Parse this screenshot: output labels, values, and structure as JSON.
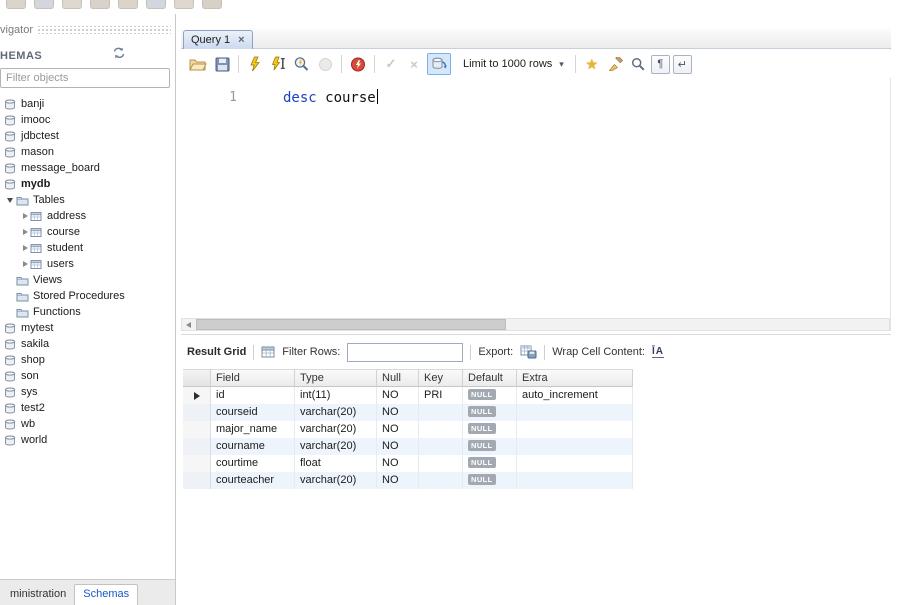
{
  "sidebar": {
    "navigator_title": "vigator",
    "schemas_title": "HEMAS",
    "filter_placeholder": "Filter objects",
    "bottom_tabs": [
      {
        "label": "ministration",
        "active": false
      },
      {
        "label": "Schemas",
        "active": true
      }
    ],
    "tree": [
      {
        "label": "banji",
        "type": "schema",
        "indent": 0
      },
      {
        "label": "imooc",
        "type": "schema",
        "indent": 0
      },
      {
        "label": "jdbctest",
        "type": "schema",
        "indent": 0
      },
      {
        "label": "mason",
        "type": "schema",
        "indent": 0
      },
      {
        "label": "message_board",
        "type": "schema",
        "indent": 0
      },
      {
        "label": "mydb",
        "type": "schema",
        "indent": 0,
        "bold": true
      },
      {
        "label": "Tables",
        "type": "folder",
        "indent": 1,
        "arrow": "down"
      },
      {
        "label": "address",
        "type": "table",
        "indent": 2,
        "arrow": "right"
      },
      {
        "label": "course",
        "type": "table",
        "indent": 2,
        "arrow": "right"
      },
      {
        "label": "student",
        "type": "table",
        "indent": 2,
        "arrow": "right"
      },
      {
        "label": "users",
        "type": "table",
        "indent": 2,
        "arrow": "right"
      },
      {
        "label": "Views",
        "type": "folder",
        "indent": 1
      },
      {
        "label": "Stored Procedures",
        "type": "folder",
        "indent": 1
      },
      {
        "label": "Functions",
        "type": "folder",
        "indent": 1
      },
      {
        "label": "mytest",
        "type": "schema",
        "indent": 0
      },
      {
        "label": "sakila",
        "type": "schema",
        "indent": 0
      },
      {
        "label": "shop",
        "type": "schema",
        "indent": 0
      },
      {
        "label": "son",
        "type": "schema",
        "indent": 0
      },
      {
        "label": "sys",
        "type": "schema",
        "indent": 0
      },
      {
        "label": "test2",
        "type": "schema",
        "indent": 0
      },
      {
        "label": "wb",
        "type": "schema",
        "indent": 0
      },
      {
        "label": "world",
        "type": "schema",
        "indent": 0
      }
    ]
  },
  "editor": {
    "tab_label": "Query 1",
    "close_glyph": "×",
    "line_number": "1",
    "sql_keyword": "desc",
    "sql_rest": " course",
    "limit_label": "Limit to 1000 rows"
  },
  "toolbar_icons": [
    "open-script-icon",
    "save-script-icon",
    "execute-icon",
    "execute-current-statement-icon",
    "explain-icon",
    "stop-icon",
    "toggle-stop-on-error-icon",
    "commit-icon",
    "rollback-icon",
    "toggle-autocommit-icon",
    "limit-rows-dropdown",
    "save-snippet-icon",
    "beautify-icon",
    "find-icon",
    "toggle-invisible-characters-icon",
    "toggle-word-wrap-icon"
  ],
  "icons": {
    "pilcrow": "¶",
    "wrap": "↵",
    "commit_check": "✓",
    "rollback_x": "×",
    "star": "★",
    "dropdown_arrow": "▾"
  },
  "result_grid": {
    "panel_label": "Result Grid",
    "filter_label": "Filter Rows:",
    "filter_value": "",
    "export_label": "Export:",
    "wrap_label": "Wrap Cell Content:",
    "wrap_icon_text": "ĪA",
    "columns": [
      "Field",
      "Type",
      "Null",
      "Key",
      "Default",
      "Extra"
    ],
    "rows": [
      {
        "field": "id",
        "type": "int(11)",
        "nullable": "NO",
        "key": "PRI",
        "default_val": "NULL",
        "extra": "auto_increment",
        "selected": true
      },
      {
        "field": "courseid",
        "type": "varchar(20)",
        "nullable": "NO",
        "key": "",
        "default_val": "NULL",
        "extra": ""
      },
      {
        "field": "major_name",
        "type": "varchar(20)",
        "nullable": "NO",
        "key": "",
        "default_val": "NULL",
        "extra": ""
      },
      {
        "field": "courname",
        "type": "varchar(20)",
        "nullable": "NO",
        "key": "",
        "default_val": "NULL",
        "extra": ""
      },
      {
        "field": "courtime",
        "type": "float",
        "nullable": "NO",
        "key": "",
        "default_val": "NULL",
        "extra": ""
      },
      {
        "field": "courteacher",
        "type": "varchar(20)",
        "nullable": "NO",
        "key": "",
        "default_val": "NULL",
        "extra": ""
      }
    ]
  }
}
